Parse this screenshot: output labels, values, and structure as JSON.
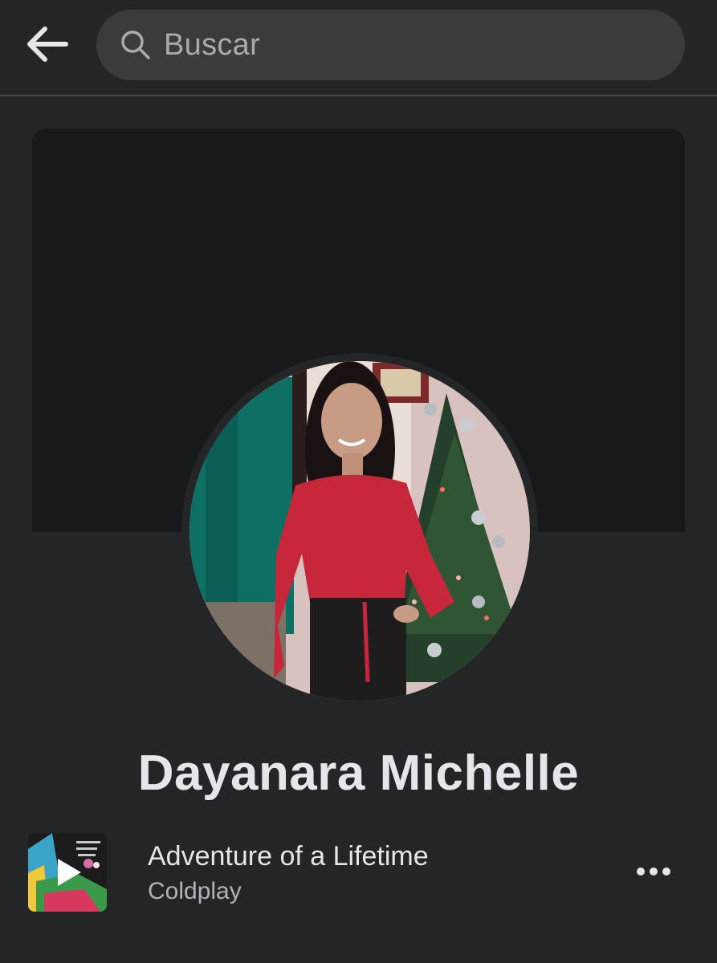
{
  "search": {
    "placeholder": "Buscar"
  },
  "profile": {
    "name": "Dayanara Michelle"
  },
  "music": {
    "title": "Adventure of a Lifetime",
    "artist": "Coldplay"
  },
  "icons": {
    "back": "arrow-left",
    "search": "magnifier",
    "play": "play-triangle",
    "more": "three-dots-horizontal"
  },
  "colors": {
    "background": "#242526",
    "cover": "#18191a",
    "search_bg": "#3a3b3c",
    "primary_text": "#e4e6eb",
    "secondary_text": "#b0b3b8"
  }
}
